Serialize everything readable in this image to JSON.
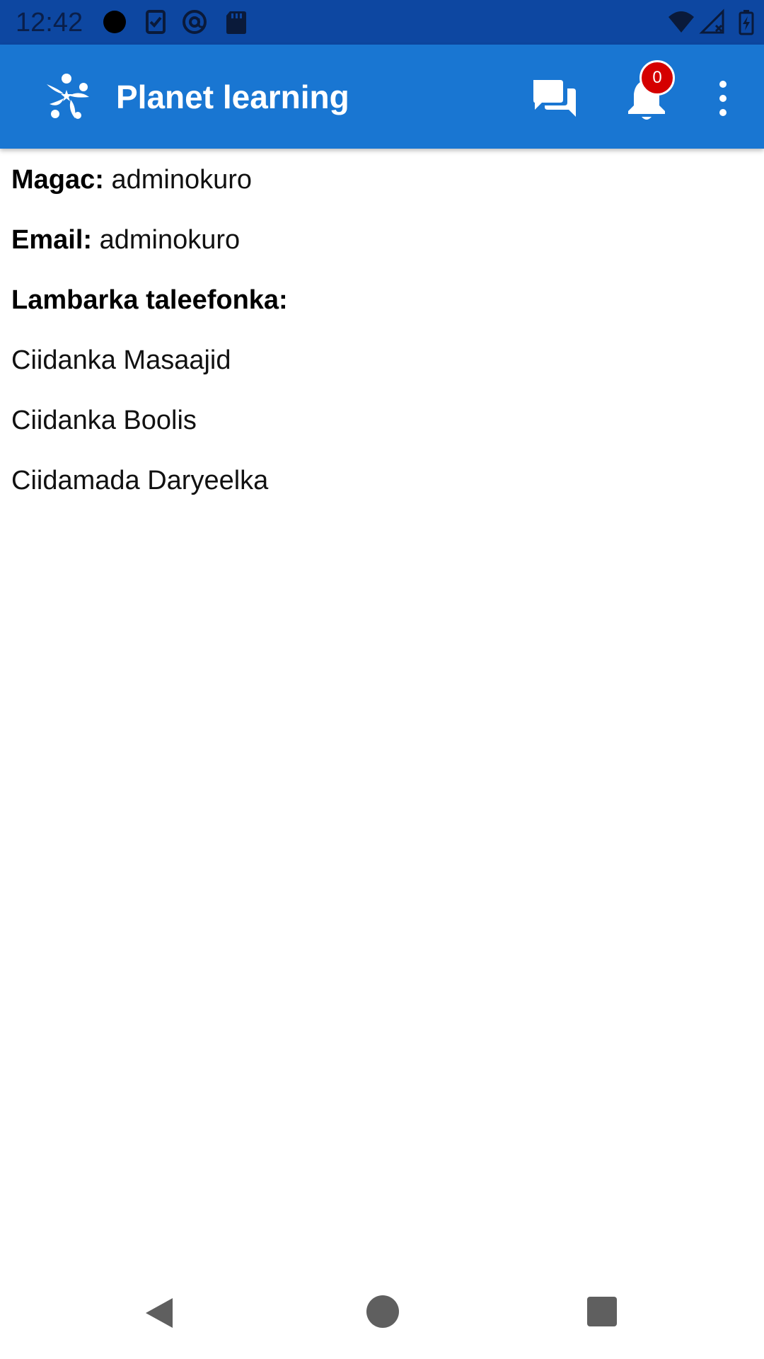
{
  "status_bar": {
    "time": "12:42",
    "icons_left": [
      "notification-dot-icon",
      "clipboard-check-icon",
      "at-sign-icon",
      "sd-card-icon"
    ],
    "icons_right": [
      "wifi-icon",
      "cell-signal-icon",
      "battery-charging-icon"
    ],
    "background": "#0d47a1"
  },
  "app_bar": {
    "title": "Planet learning",
    "background": "#1976d2",
    "notification_count": "0",
    "badge_color": "#d50000"
  },
  "profile": {
    "name_label": "Magac:",
    "name_value": "adminokuro",
    "email_label": "Email:",
    "email_value": "adminokuro",
    "phone_label": "Lambarka taleefonka:",
    "groups": [
      "Ciidanka Masaajid",
      "Ciidanka Boolis",
      "Ciidamada Daryeelka"
    ]
  },
  "nav_bar": {
    "buttons": [
      "back",
      "home",
      "recents"
    ]
  }
}
